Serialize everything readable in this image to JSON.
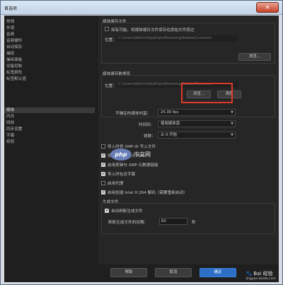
{
  "window": {
    "title": "首选项",
    "close_glyph": "✕"
  },
  "sidebar": {
    "items": [
      "常规",
      "外观",
      "音频",
      "音频硬件",
      "自动保存",
      "捕捉",
      "操纵面板",
      "设备控制",
      "标签颜色",
      "标签默认值",
      "媒体",
      "内存",
      "回放",
      "同步设置",
      "字幕",
      "修剪"
    ],
    "active_index": 10
  },
  "media_cache_files": {
    "group_label": "媒体缓存文件",
    "checkbox_label": "如有可能，将媒体缓存文件保存在原始文件旁边",
    "location_label": "位置：",
    "path": "C:\\Users\\Admin\\AppData\\Roaming\\Adobe\\Common",
    "browse_label": "浏览..."
  },
  "media_cache_db": {
    "group_label": "媒体缓存数据库",
    "location_label": "位置：",
    "path": "C:\\Users\\Admin\\AppData\\Roaming\\Adobe\\Common",
    "browse_label": "浏览...",
    "clean_label": "清理"
  },
  "settings": {
    "frame_rate_label": "不确定的媒体时基：",
    "frame_rate_value": "25.00 fps",
    "timecode_label": "时间码：",
    "timecode_value": "使用媒体源",
    "frame_number_label": "帧数：",
    "frame_number_value": "从 0 开始"
  },
  "checkboxes": [
    {
      "label": "导入时将 XMP ID 写入文件",
      "checked": false
    },
    {
      "label": "将剪辑标记写入 XMP",
      "checked": true
    },
    {
      "label": "启用剪辑与 XMP 元数据链接",
      "checked": true
    },
    {
      "label": "导入时包含字幕",
      "checked": true
    },
    {
      "label": "启用代理",
      "checked": false
    },
    {
      "label": "启用加速 Intel H.264 解码（需要重新启动）",
      "checked": true
    }
  ],
  "growing_files": {
    "group_label": "生成文件",
    "auto_refresh_label": "自动刷新生成文件",
    "auto_refresh_checked": true,
    "interval_label": "刷新生成文件的间隔：",
    "interval_value": "60",
    "interval_unit": "秒"
  },
  "footer": {
    "help_label": "帮助",
    "cancel_label": "取消",
    "ok_label": "确定"
  },
  "overlay": {
    "logo_text": "php",
    "logo_caption": "中文网",
    "watermark_main": "Bai 经验",
    "watermark_sub": "jingyan.baidu.com"
  },
  "colors": {
    "highlight": "#e03a2b",
    "ok_button": "#2d6fc6",
    "panel_bg": "#262626"
  }
}
